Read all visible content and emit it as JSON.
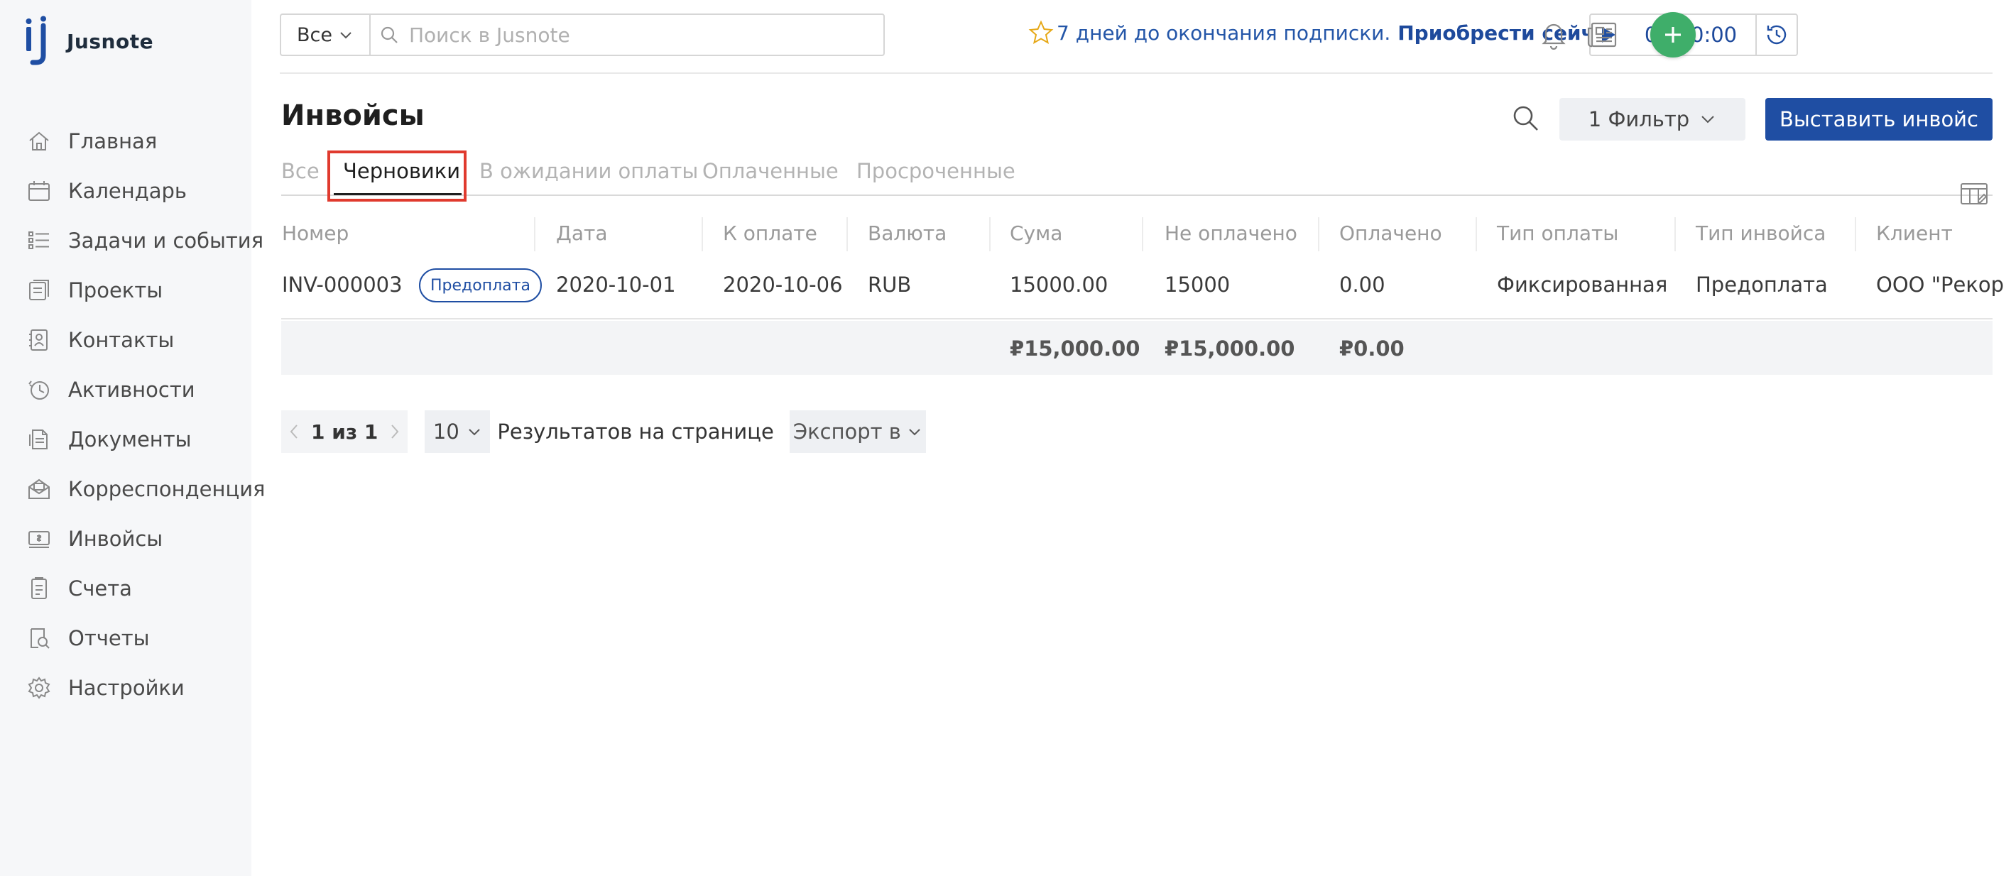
{
  "app": {
    "name": "Jusnote",
    "brand_color": "#1f4ea3",
    "accent_green": "#3fae6a",
    "highlight_red": "#e03a2e"
  },
  "sidebar": {
    "items": [
      {
        "label": "Главная",
        "icon": "home-icon"
      },
      {
        "label": "Календарь",
        "icon": "calendar-icon"
      },
      {
        "label": "Задачи и события",
        "icon": "tasks-icon"
      },
      {
        "label": "Проекты",
        "icon": "projects-icon"
      },
      {
        "label": "Контакты",
        "icon": "contacts-icon"
      },
      {
        "label": "Активности",
        "icon": "activity-icon"
      },
      {
        "label": "Документы",
        "icon": "documents-icon"
      },
      {
        "label": "Корреспонденция",
        "icon": "correspondence-icon"
      },
      {
        "label": "Инвойсы",
        "icon": "invoices-icon"
      },
      {
        "label": "Счета",
        "icon": "accounts-icon"
      },
      {
        "label": "Отчеты",
        "icon": "reports-icon"
      },
      {
        "label": "Настройки",
        "icon": "settings-icon"
      }
    ]
  },
  "topbar": {
    "scope": "Все",
    "search_placeholder": "Поиск в Jusnote",
    "subscription_text": "7 дней до окончания подписки.",
    "subscription_link": "Приобрести сейчас",
    "timer": "00:00:00"
  },
  "page": {
    "title": "Инвойсы",
    "filter_label": "1 Фильтр",
    "issue_button": "Выставить инвойс"
  },
  "tabs": [
    {
      "label": "Все",
      "active": false
    },
    {
      "label": "Черновики",
      "active": true
    },
    {
      "label": "В ожидании оплаты",
      "active": false
    },
    {
      "label": "Оплаченные",
      "active": false
    },
    {
      "label": "Просроченные",
      "active": false
    }
  ],
  "table": {
    "headers": [
      "Номер",
      "Дата",
      "К оплате",
      "Валюта",
      "Сума",
      "Не оплачено",
      "Оплачено",
      "Тип оплаты",
      "Тип инвойса",
      "Клиент"
    ],
    "rows": [
      {
        "number": "INV-000003",
        "badge": "Предоплата",
        "date": "2020-10-01",
        "due": "2020-10-06",
        "currency": "RUB",
        "sum": "15000.00",
        "unpaid": "15000",
        "paid": "0.00",
        "payment_type": "Фиксированная",
        "invoice_type": "Предоплата",
        "client": "ООО \"Рекор"
      }
    ],
    "totals": {
      "sum": "₽15,000.00",
      "unpaid": "₽15,000.00",
      "paid": "₽0.00"
    }
  },
  "pagination": {
    "info": "1 из 1",
    "per_page": "10",
    "per_page_label": "Результатов на странице",
    "export_label": "Экспорт в"
  }
}
